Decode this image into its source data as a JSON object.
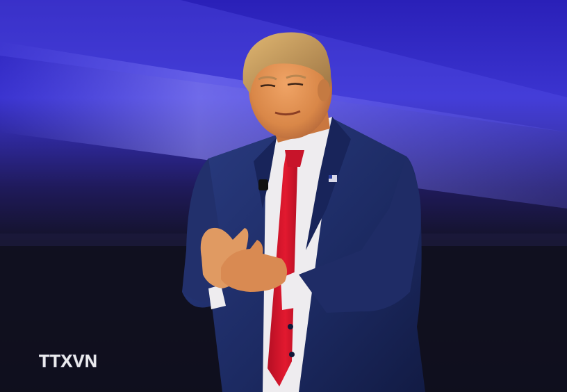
{
  "photo": {
    "watermark_text": "TTXVN",
    "colors": {
      "backdrop_blue": "#4a3fd6",
      "beam_light": "#8a86ff",
      "floor_dark": "#15142b",
      "suit_navy": "#1f2f6b",
      "shirt_white": "#f2f0f2",
      "tie_red": "#d3142b",
      "skin": "#e0945a",
      "hair": "#c99a54",
      "watermark": "#ffffff"
    }
  }
}
